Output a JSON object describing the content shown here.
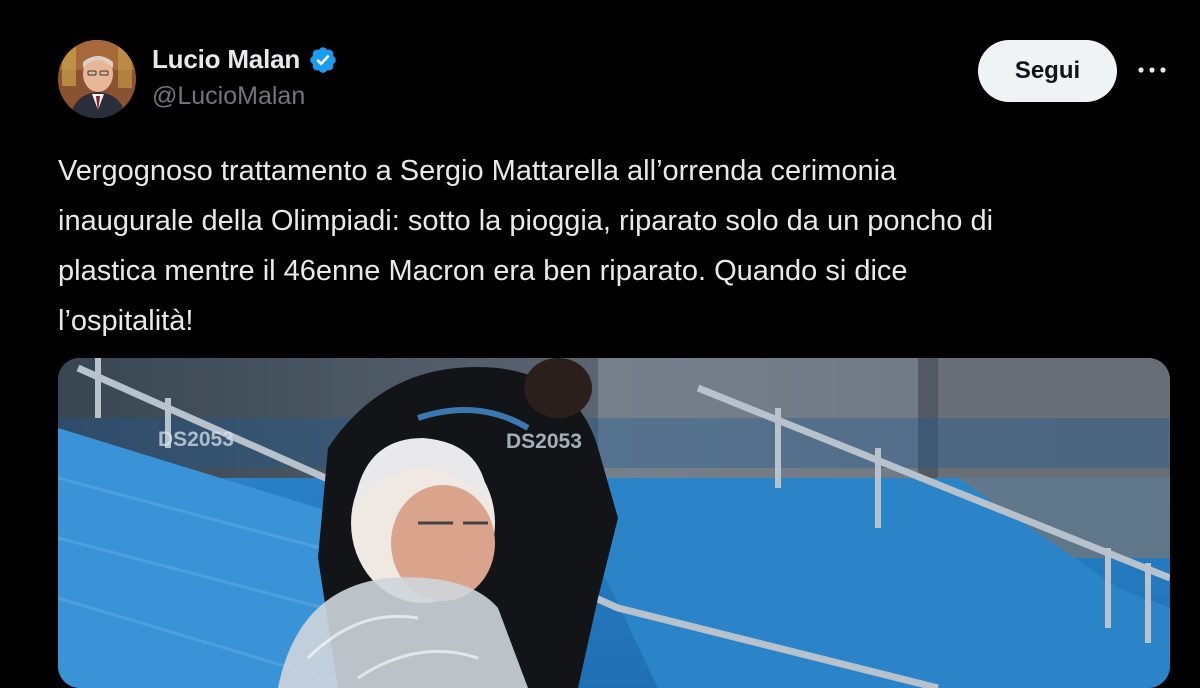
{
  "author": {
    "display_name": "Lucio Malan",
    "handle": "@LucioMalan",
    "verified": true,
    "avatar_icon": "avatar"
  },
  "actions": {
    "follow_label": "Segui",
    "more_icon": "more-horizontal-icon"
  },
  "tweet": {
    "text": "Vergognoso trattamento a Sergio Mattarella all’orrenda cerimonia\ninaugurale della Olimpiadi: sotto la pioggia, riparato solo da un poncho di\nplastica mentre il 46enne Macron era ben riparato. Quando si dice\nl’ospitalità!"
  },
  "media": {
    "watermarks": [
      "DS2053",
      "DS2053"
    ]
  },
  "colors": {
    "background": "#000000",
    "text": "#e7e9ea",
    "secondary": "#71767b",
    "verified": "#1d9bf0",
    "follow_bg": "#eff3f4"
  }
}
